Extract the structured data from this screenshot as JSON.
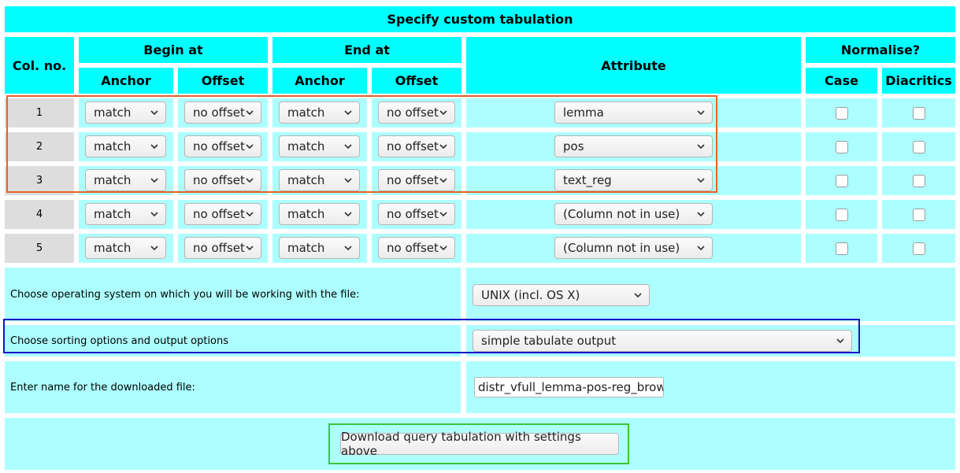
{
  "title": "Specify custom tabulation",
  "headers": {
    "col_no": "Col. no.",
    "begin_at": "Begin at",
    "end_at": "End at",
    "attribute": "Attribute",
    "normalise": "Normalise?",
    "anchor": "Anchor",
    "offset": "Offset",
    "case": "Case",
    "diacritics": "Diacritics"
  },
  "rows": [
    {
      "num": "1",
      "begin_anchor": "match",
      "begin_offset": "no offset",
      "end_anchor": "match",
      "end_offset": "no offset",
      "attribute": "lemma",
      "case_checked": false,
      "diacritics_checked": false
    },
    {
      "num": "2",
      "begin_anchor": "match",
      "begin_offset": "no offset",
      "end_anchor": "match",
      "end_offset": "no offset",
      "attribute": "pos",
      "case_checked": false,
      "diacritics_checked": false
    },
    {
      "num": "3",
      "begin_anchor": "match",
      "begin_offset": "no offset",
      "end_anchor": "match",
      "end_offset": "no offset",
      "attribute": "text_reg",
      "case_checked": false,
      "diacritics_checked": false
    },
    {
      "num": "4",
      "begin_anchor": "match",
      "begin_offset": "no offset",
      "end_anchor": "match",
      "end_offset": "no offset",
      "attribute": "(Column not in use)",
      "case_checked": false,
      "diacritics_checked": false
    },
    {
      "num": "5",
      "begin_anchor": "match",
      "begin_offset": "no offset",
      "end_anchor": "match",
      "end_offset": "no offset",
      "attribute": "(Column not in use)",
      "case_checked": false,
      "diacritics_checked": false
    }
  ],
  "os": {
    "label": "Choose operating system on which you will be working with the file:",
    "value": "UNIX (incl. OS X)"
  },
  "sorting": {
    "label": "Choose sorting options and output options",
    "value": "simple tabulate output"
  },
  "filename": {
    "label": "Enter name for the downloaded file:",
    "value": "distr_vfull_lemma-pos-reg_brown"
  },
  "download_button": "Download query tabulation with settings above",
  "colors": {
    "header_bg": "#00ffff",
    "row_bg": "#adffff",
    "number_bg": "#dddddd",
    "highlight_orange": "#e8602c",
    "highlight_blue": "#1414c8",
    "highlight_green": "#3cc43c"
  }
}
